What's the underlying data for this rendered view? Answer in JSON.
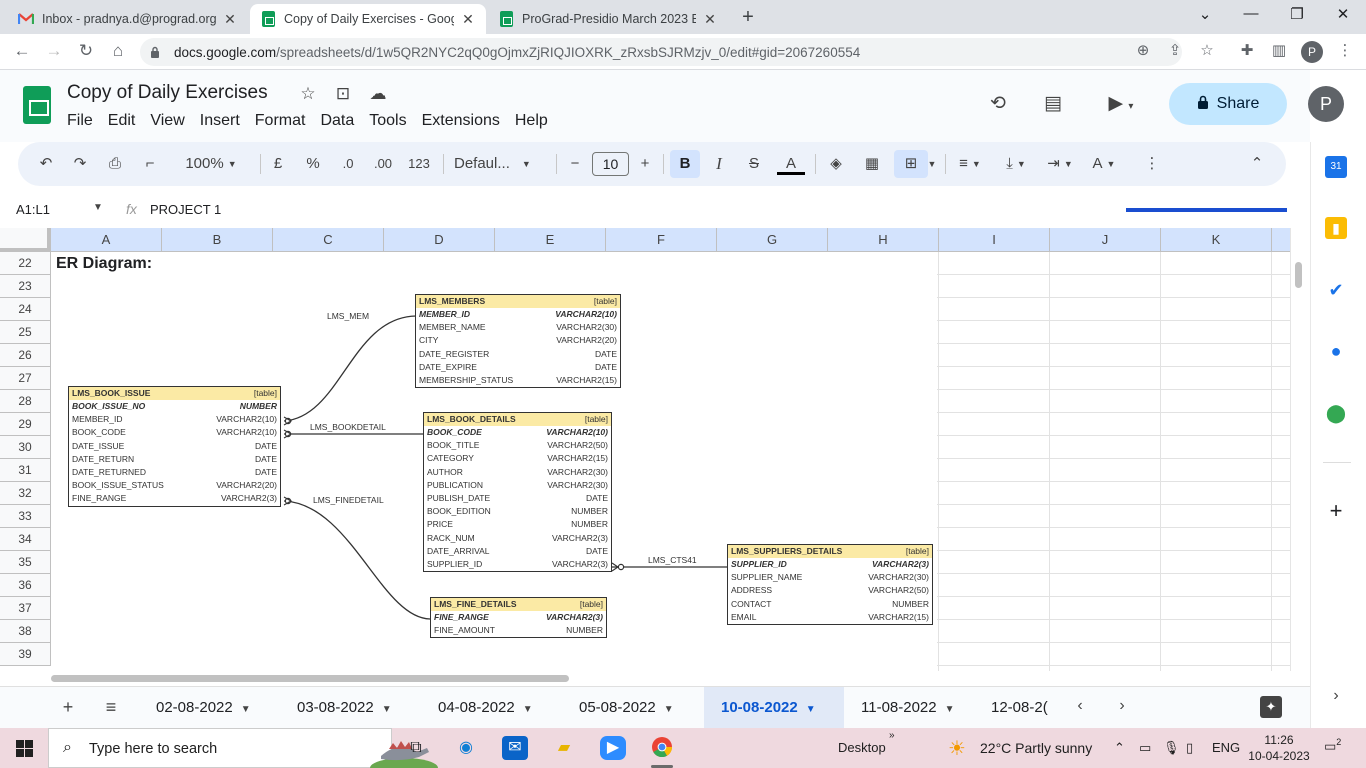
{
  "browser": {
    "tabs": [
      {
        "title": "Inbox - pradnya.d@prograd.org",
        "icon": "gmail-icon",
        "active": false
      },
      {
        "title": "Copy of Daily Exercises - Google",
        "icon": "sheets-icon",
        "active": true
      },
      {
        "title": "ProGrad-Presidio March 2023 Ba",
        "icon": "sheets-icon",
        "active": false
      }
    ],
    "url_host": "docs.google.com",
    "url_path": "/spreadsheets/d/1w5QR2NYC2qQ0gOjmxZjRIQJIOXRK_zRxsbSJRMzjv_0/edit#gid=2067260554",
    "profile_initial": "P"
  },
  "doc": {
    "title": "Copy of Daily Exercises",
    "menu": [
      "File",
      "Edit",
      "View",
      "Insert",
      "Format",
      "Data",
      "Tools",
      "Extensions",
      "Help"
    ],
    "share_label": "Share",
    "account_initial": "P"
  },
  "toolbar": {
    "zoom": "100%",
    "currency": "£",
    "percent": "%",
    "dec_minus": ".0",
    "dec_plus": ".00",
    "number_format": "123",
    "font": "Defaul...",
    "font_size": "10"
  },
  "formula_bar": {
    "name_box": "A1:L1",
    "fx": "fx",
    "content": "PROJECT 1"
  },
  "grid": {
    "columns": [
      "A",
      "B",
      "C",
      "D",
      "E",
      "F",
      "G",
      "H",
      "I",
      "J",
      "K"
    ],
    "rows": [
      "22",
      "23",
      "24",
      "25",
      "26",
      "27",
      "28",
      "29",
      "30",
      "31",
      "32",
      "33",
      "34",
      "35",
      "36",
      "37",
      "38",
      "39"
    ],
    "er_title": "ER Diagram:"
  },
  "er_diagram": {
    "tables": [
      {
        "name": "LMS_MEMBERS",
        "tag": "[table]",
        "columns": [
          {
            "name": "MEMBER_ID",
            "type": "VARCHAR2(10)",
            "pk": true
          },
          {
            "name": "MEMBER_NAME",
            "type": "VARCHAR2(30)"
          },
          {
            "name": "CITY",
            "type": "VARCHAR2(20)"
          },
          {
            "name": "DATE_REGISTER",
            "type": "DATE"
          },
          {
            "name": "DATE_EXPIRE",
            "type": "DATE"
          },
          {
            "name": "MEMBERSHIP_STATUS",
            "type": "VARCHAR2(15)"
          }
        ]
      },
      {
        "name": "LMS_BOOK_ISSUE",
        "tag": "[table]",
        "columns": [
          {
            "name": "BOOK_ISSUE_NO",
            "type": "NUMBER",
            "pk": true
          },
          {
            "name": "MEMBER_ID",
            "type": "VARCHAR2(10)"
          },
          {
            "name": "BOOK_CODE",
            "type": "VARCHAR2(10)"
          },
          {
            "name": "DATE_ISSUE",
            "type": "DATE"
          },
          {
            "name": "DATE_RETURN",
            "type": "DATE"
          },
          {
            "name": "DATE_RETURNED",
            "type": "DATE"
          },
          {
            "name": "BOOK_ISSUE_STATUS",
            "type": "VARCHAR2(20)"
          },
          {
            "name": "FINE_RANGE",
            "type": "VARCHAR2(3)"
          }
        ]
      },
      {
        "name": "LMS_BOOK_DETAILS",
        "tag": "[table]",
        "columns": [
          {
            "name": "BOOK_CODE",
            "type": "VARCHAR2(10)",
            "pk": true
          },
          {
            "name": "BOOK_TITLE",
            "type": "VARCHAR2(50)"
          },
          {
            "name": "CATEGORY",
            "type": "VARCHAR2(15)"
          },
          {
            "name": "AUTHOR",
            "type": "VARCHAR2(30)"
          },
          {
            "name": "PUBLICATION",
            "type": "VARCHAR2(30)"
          },
          {
            "name": "PUBLISH_DATE",
            "type": "DATE"
          },
          {
            "name": "BOOK_EDITION",
            "type": "NUMBER"
          },
          {
            "name": "PRICE",
            "type": "NUMBER"
          },
          {
            "name": "RACK_NUM",
            "type": "VARCHAR2(3)"
          },
          {
            "name": "DATE_ARRIVAL",
            "type": "DATE"
          },
          {
            "name": "SUPPLIER_ID",
            "type": "VARCHAR2(3)"
          }
        ]
      },
      {
        "name": "LMS_FINE_DETAILS",
        "tag": "[table]",
        "columns": [
          {
            "name": "FINE_RANGE",
            "type": "VARCHAR2(3)",
            "pk": true
          },
          {
            "name": "FINE_AMOUNT",
            "type": "NUMBER"
          }
        ]
      },
      {
        "name": "LMS_SUPPLIERS_DETAILS",
        "tag": "[table]",
        "columns": [
          {
            "name": "SUPPLIER_ID",
            "type": "VARCHAR2(3)",
            "pk": true
          },
          {
            "name": "SUPPLIER_NAME",
            "type": "VARCHAR2(30)"
          },
          {
            "name": "ADDRESS",
            "type": "VARCHAR2(50)"
          },
          {
            "name": "CONTACT",
            "type": "NUMBER"
          },
          {
            "name": "EMAIL",
            "type": "VARCHAR2(15)"
          }
        ]
      }
    ],
    "relationships": [
      "LMS_MEM",
      "LMS_BOOKDETAIL",
      "LMS_FINEDETAIL",
      "LMS_CTS41"
    ]
  },
  "sheets": {
    "tabs": [
      "02-08-2022",
      "03-08-2022",
      "04-08-2022",
      "05-08-2022",
      "10-08-2022",
      "11-08-2022",
      "12-08-2("
    ],
    "active": "10-08-2022"
  },
  "taskbar": {
    "search_placeholder": "Type here to search",
    "desktop_label": "Desktop",
    "weather": "22°C  Partly sunny",
    "language": "ENG",
    "time": "11:26",
    "date": "10-04-2023",
    "notification_count": "2"
  }
}
